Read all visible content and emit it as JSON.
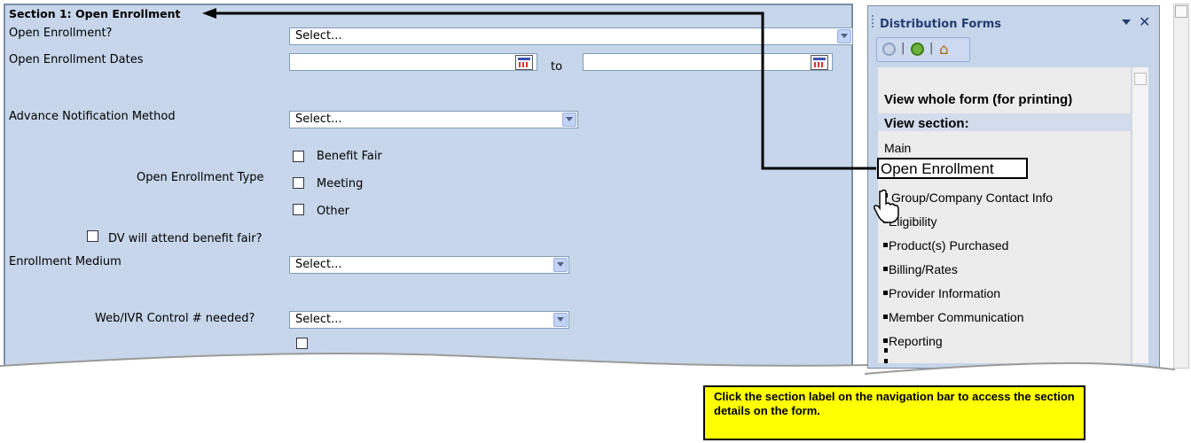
{
  "form": {
    "section_title": "Section 1: Open Enrollment",
    "open_enrollment_label": "Open Enrollment?",
    "open_enrollment_value": "Select...",
    "dates_label": "Open Enrollment Dates",
    "dates_to": "to",
    "notification_label": "Advance Notification Method",
    "notification_value": "Select...",
    "type_label": "Open Enrollment Type",
    "type_options": [
      "Benefit Fair",
      "Meeting",
      "Other"
    ],
    "dv_attend_label": "DV will attend benefit fair?",
    "medium_label": "Enrollment Medium",
    "medium_value": "Select...",
    "web_ivr_label": "Web/IVR Control # needed?",
    "web_ivr_value": "Select..."
  },
  "sidebar": {
    "title": "Distribution Forms",
    "view_whole": "View whole form (for printing)",
    "view_section": "View section:",
    "items": [
      "Main",
      "Open Enrollment",
      "Group/Company Contact Info",
      "Eligibility",
      "Product(s) Purchased",
      "Billing/Rates",
      "Provider Information",
      "Member Communication",
      "Reporting"
    ]
  },
  "callout": {
    "text": "Click the section label on the navigation bar to access the section details on the form."
  },
  "colors": {
    "panel": "#c7d6ea",
    "callout": "#ffff00",
    "sidebar_title": "#233d74"
  }
}
